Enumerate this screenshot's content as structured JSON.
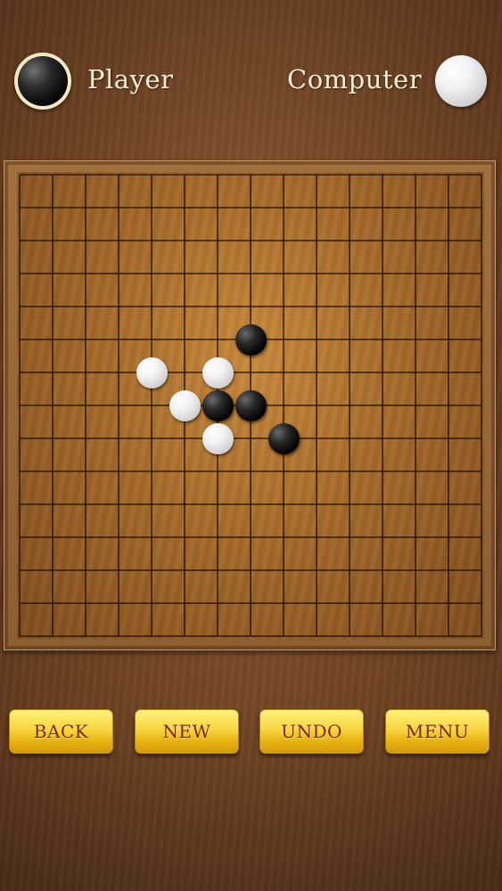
{
  "header": {
    "player_label": "Player",
    "computer_label": "Computer",
    "player_stone_color": "black",
    "computer_stone_color": "white"
  },
  "board": {
    "size": 15,
    "lines": 15,
    "stones": [
      {
        "col": 7,
        "row": 5,
        "color": "black"
      },
      {
        "col": 4,
        "row": 6,
        "color": "white"
      },
      {
        "col": 6,
        "row": 6,
        "color": "white"
      },
      {
        "col": 5,
        "row": 7,
        "color": "white"
      },
      {
        "col": 6,
        "row": 7,
        "color": "black"
      },
      {
        "col": 7,
        "row": 7,
        "color": "black"
      },
      {
        "col": 6,
        "row": 8,
        "color": "white"
      },
      {
        "col": 8,
        "row": 8,
        "color": "black"
      }
    ]
  },
  "buttons": {
    "back": "BACK",
    "new": "NEW",
    "undo": "UNDO",
    "menu": "MENU"
  },
  "colors": {
    "button_text": "#7a2a12",
    "button_face": "#f8d640",
    "board_line": "#1a0d04"
  }
}
